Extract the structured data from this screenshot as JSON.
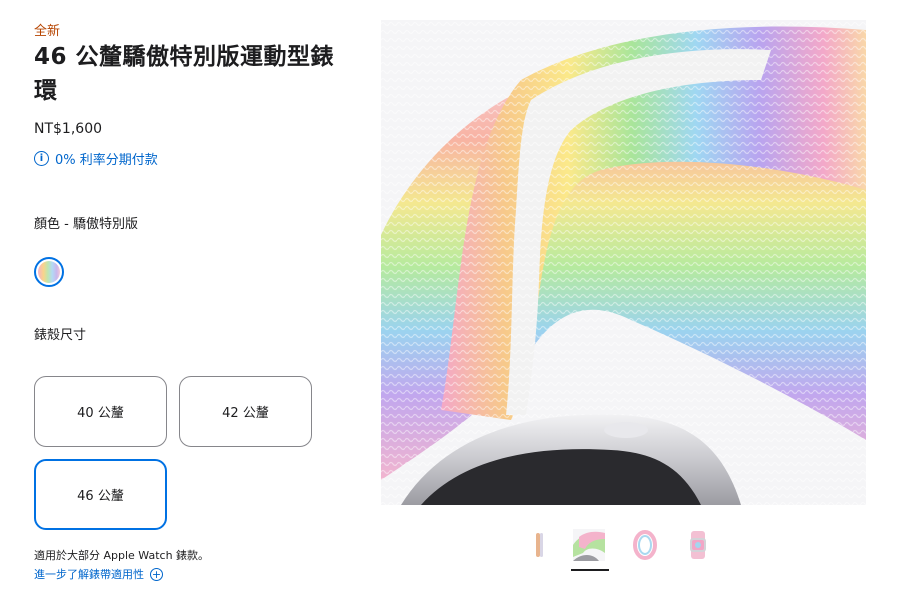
{
  "product": {
    "badge": "全新",
    "title": "46 公釐驕傲特別版運動型錶環",
    "price": "NT$1,600",
    "installment_text": "0% 利率分期付款"
  },
  "color": {
    "label": "顏色 - 驕傲特別版",
    "selected_swatch": "pride-edition"
  },
  "case_size": {
    "label": "錶殼尺寸",
    "options": [
      "40 公釐",
      "42 公釐",
      "46 公釐"
    ],
    "selected": "46 公釐"
  },
  "compatibility": {
    "note": "適用於大部分 Apple Watch 錶款。",
    "link": "進一步了解錶帶適用性"
  },
  "gallery": {
    "thumbnail_count": 4,
    "selected_index": 1
  },
  "colors": {
    "accent": "#0071e3",
    "link": "#0066cc",
    "badge": "#b64400",
    "text": "#1d1d1f",
    "hero_bg": "#f5f5f7"
  }
}
